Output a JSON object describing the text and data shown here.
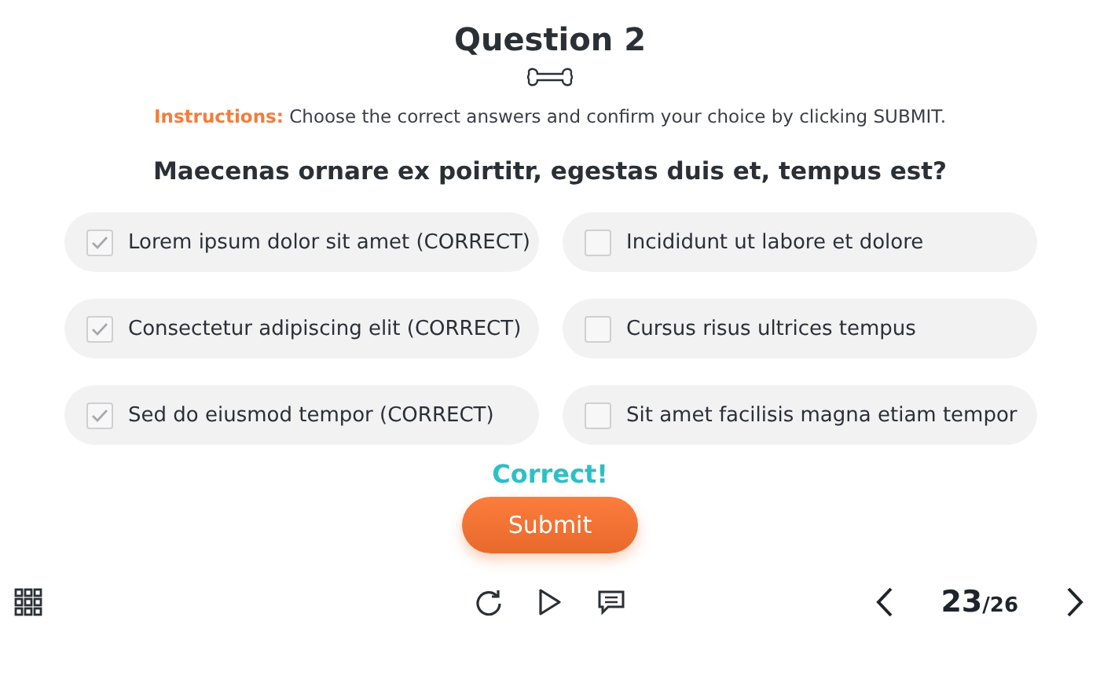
{
  "title": "Question 2",
  "instructions": "**Instructions:** Choose the correct answers and confirm your choice by clicking SUBMIT.",
  "question": "Maecenas ornare ex poirtitr, egestas duis et, tempus est?",
  "options": [
    {
      "label": "Lorem ipsum dolor sit amet (CORRECT)",
      "checked": true
    },
    {
      "label": "Incididunt ut labore et dolore",
      "checked": false
    },
    {
      "label": "Consectetur adipiscing elit (CORRECT)",
      "checked": true
    },
    {
      "label": "Cursus risus ultrices tempus",
      "checked": false
    },
    {
      "label": "Sed do eiusmod tempor (CORRECT)",
      "checked": true
    },
    {
      "label": "Sit amet facilisis magna etiam tempor",
      "checked": false
    }
  ],
  "feedback": "Correct!",
  "submit_button": "Submit",
  "pager": {
    "current": "23",
    "total": "/26"
  }
}
